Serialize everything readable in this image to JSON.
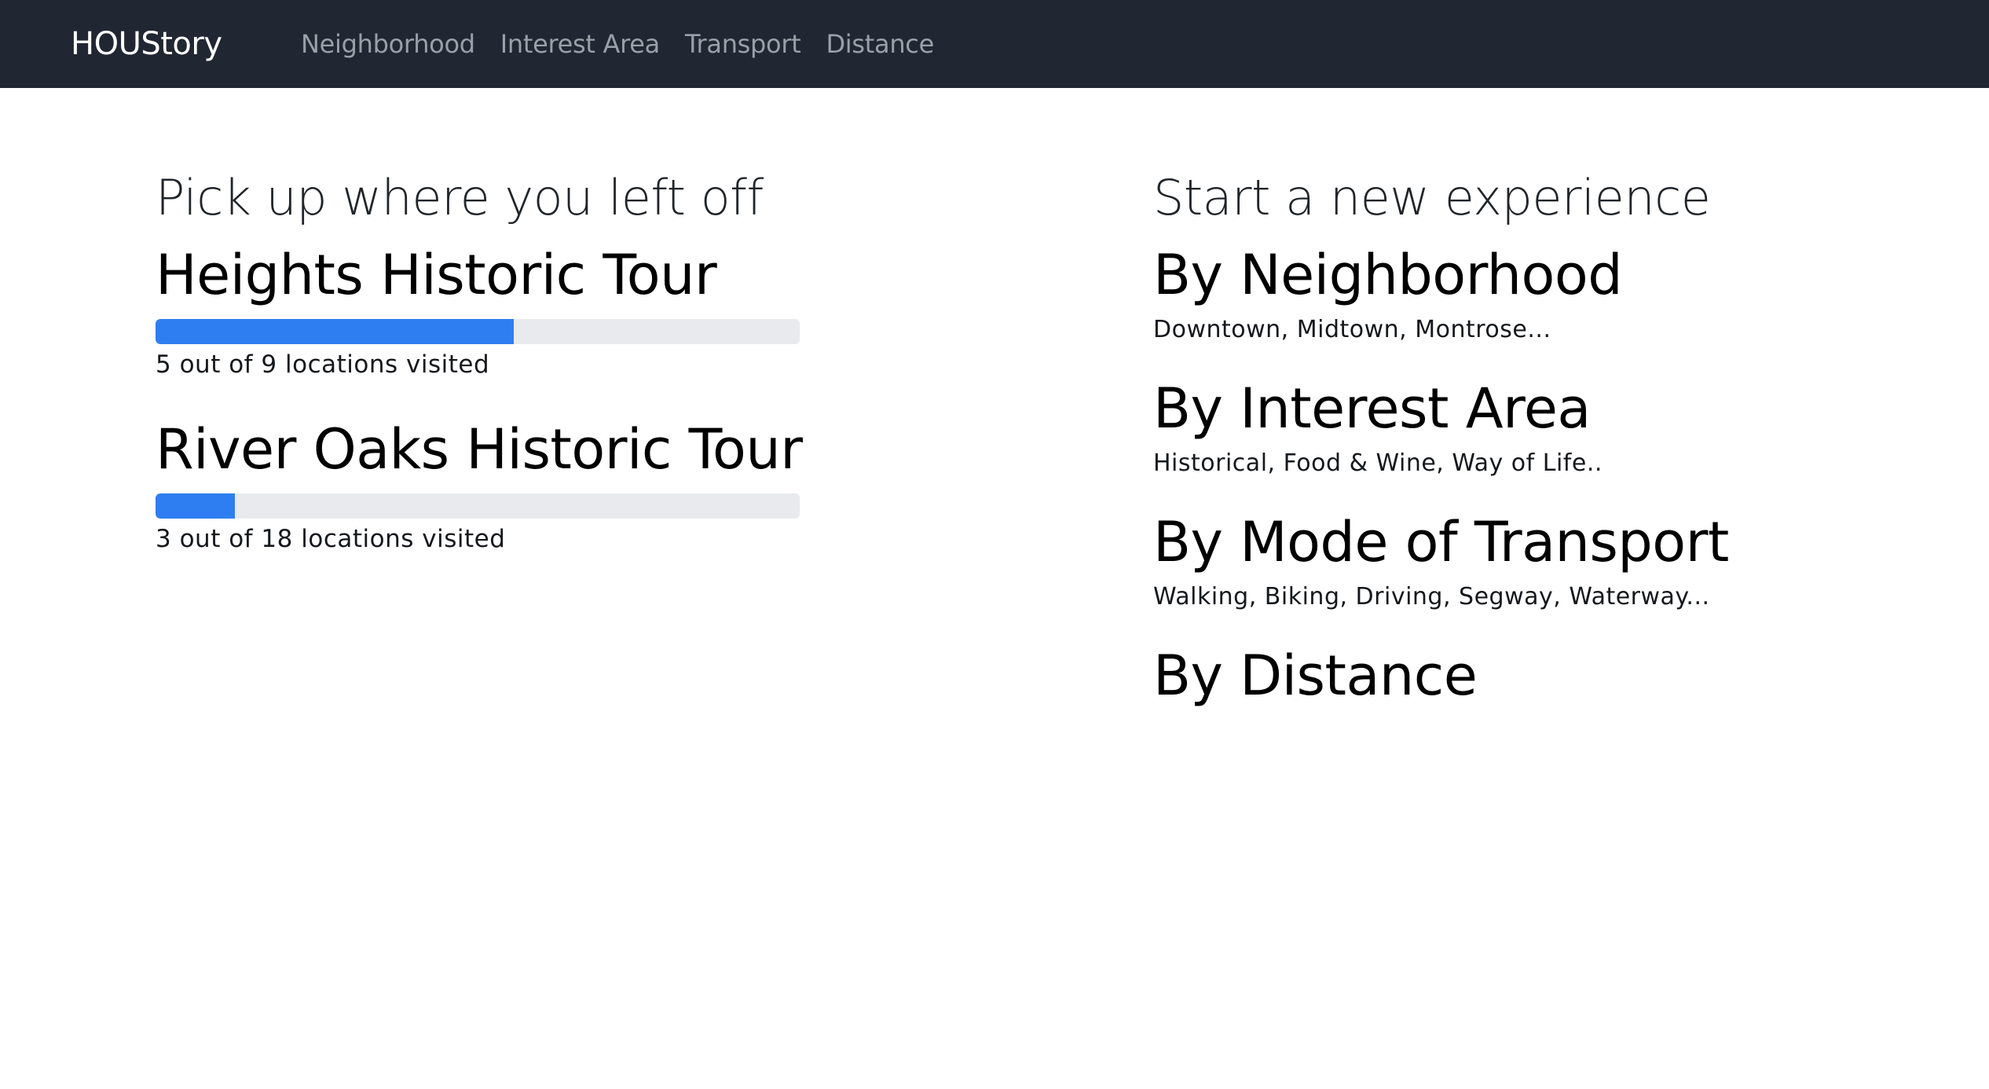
{
  "navbar": {
    "brand": "HOUStory",
    "links": [
      {
        "label": "Neighborhood"
      },
      {
        "label": "Interest Area"
      },
      {
        "label": "Transport"
      },
      {
        "label": "Distance"
      }
    ]
  },
  "resume": {
    "title": "Pick up where you left off",
    "tours": [
      {
        "name": "Heights Historic Tour",
        "progress_text": "5 out of 9 locations visited",
        "progress_fraction": 0.556
      },
      {
        "name": "River Oaks Historic Tour",
        "progress_text": "3 out of 18 locations visited",
        "progress_fraction": 0.123
      }
    ]
  },
  "new_experience": {
    "title": "Start a new experience",
    "options": [
      {
        "label": "By Neighborhood",
        "desc": "Downtown, Midtown, Montrose..."
      },
      {
        "label": "By Interest Area",
        "desc": "Historical, Food & Wine, Way of Life.."
      },
      {
        "label": "By Mode of Transport",
        "desc": "Walking, Biking, Driving, Segway, Waterway..."
      },
      {
        "label": "By Distance",
        "desc": ""
      }
    ]
  },
  "colors": {
    "navbar_bg": "#212732",
    "progress_fill": "#2f7ef1",
    "progress_track": "#e9eaee"
  }
}
